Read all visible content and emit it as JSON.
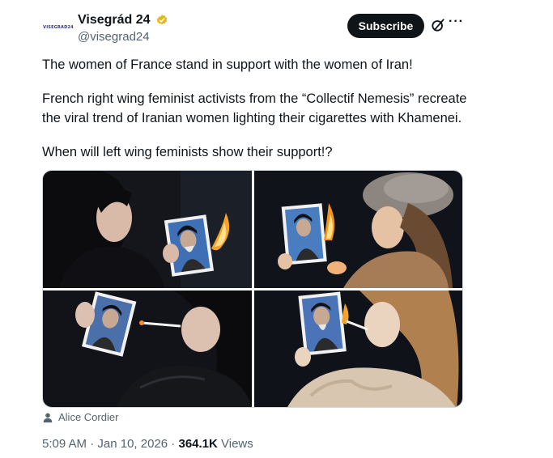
{
  "author": {
    "avatar_text": "VISEGRAD24",
    "name": "Visegrád 24",
    "handle": "@visegrad24",
    "verified_color": "#e2b719"
  },
  "actions": {
    "subscribe_label": "Subscribe",
    "grok_icon": "grok-icon",
    "more_icon": "more-icon"
  },
  "post": {
    "line1": "The women of France stand in support with the women of Iran!",
    "line2": "French right wing feminist activists from the “Collectif Nemesis” recreate",
    "line3": "the viral trend of Iranian women lighting their cigarettes with Khamenei.",
    "line4": "When will left wing feminists show their support!?"
  },
  "media": {
    "photos": [
      "woman-burning-portrait-photo",
      "woman-in-fur-hat-burning-portrait-photo",
      "woman-lighting-cigarette-photo",
      "blonde-woman-lighting-cigarette-photo"
    ],
    "credit_icon": "person-icon",
    "credit": "Alice Cordier"
  },
  "meta": {
    "time": "5:09 AM",
    "separator1": " · ",
    "date": "Jan 10, 2026",
    "separator2": " · ",
    "views_count": "364.1K",
    "views_label": " Views"
  },
  "colors": {
    "text_primary": "#0f1419",
    "text_secondary": "#536471",
    "button_bg": "#0f1419",
    "border": "#cfd9de"
  }
}
